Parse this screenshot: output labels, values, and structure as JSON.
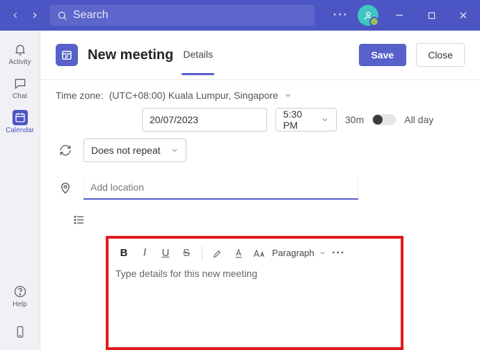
{
  "titlebar": {
    "search_placeholder": "Search"
  },
  "rail": {
    "activity": "Activity",
    "chat": "Chat",
    "calendar": "Calendar",
    "help": "Help"
  },
  "page": {
    "title": "New meeting",
    "tab": "Details",
    "save": "Save",
    "close": "Close"
  },
  "timezone": {
    "label": "Time zone:",
    "value": "(UTC+08:00) Kuala Lumpur, Singapore"
  },
  "datetime": {
    "date": "20/07/2023",
    "time": "5:30 PM",
    "duration": "30m",
    "all_day": "All day"
  },
  "recurrence": {
    "value": "Does not repeat"
  },
  "location": {
    "placeholder": "Add location"
  },
  "editor": {
    "placeholder": "Type details for this new meeting",
    "paragraph_label": "Paragraph",
    "buttons": {
      "bold": "B",
      "italic": "I",
      "underline": "U",
      "strike": "S"
    }
  }
}
